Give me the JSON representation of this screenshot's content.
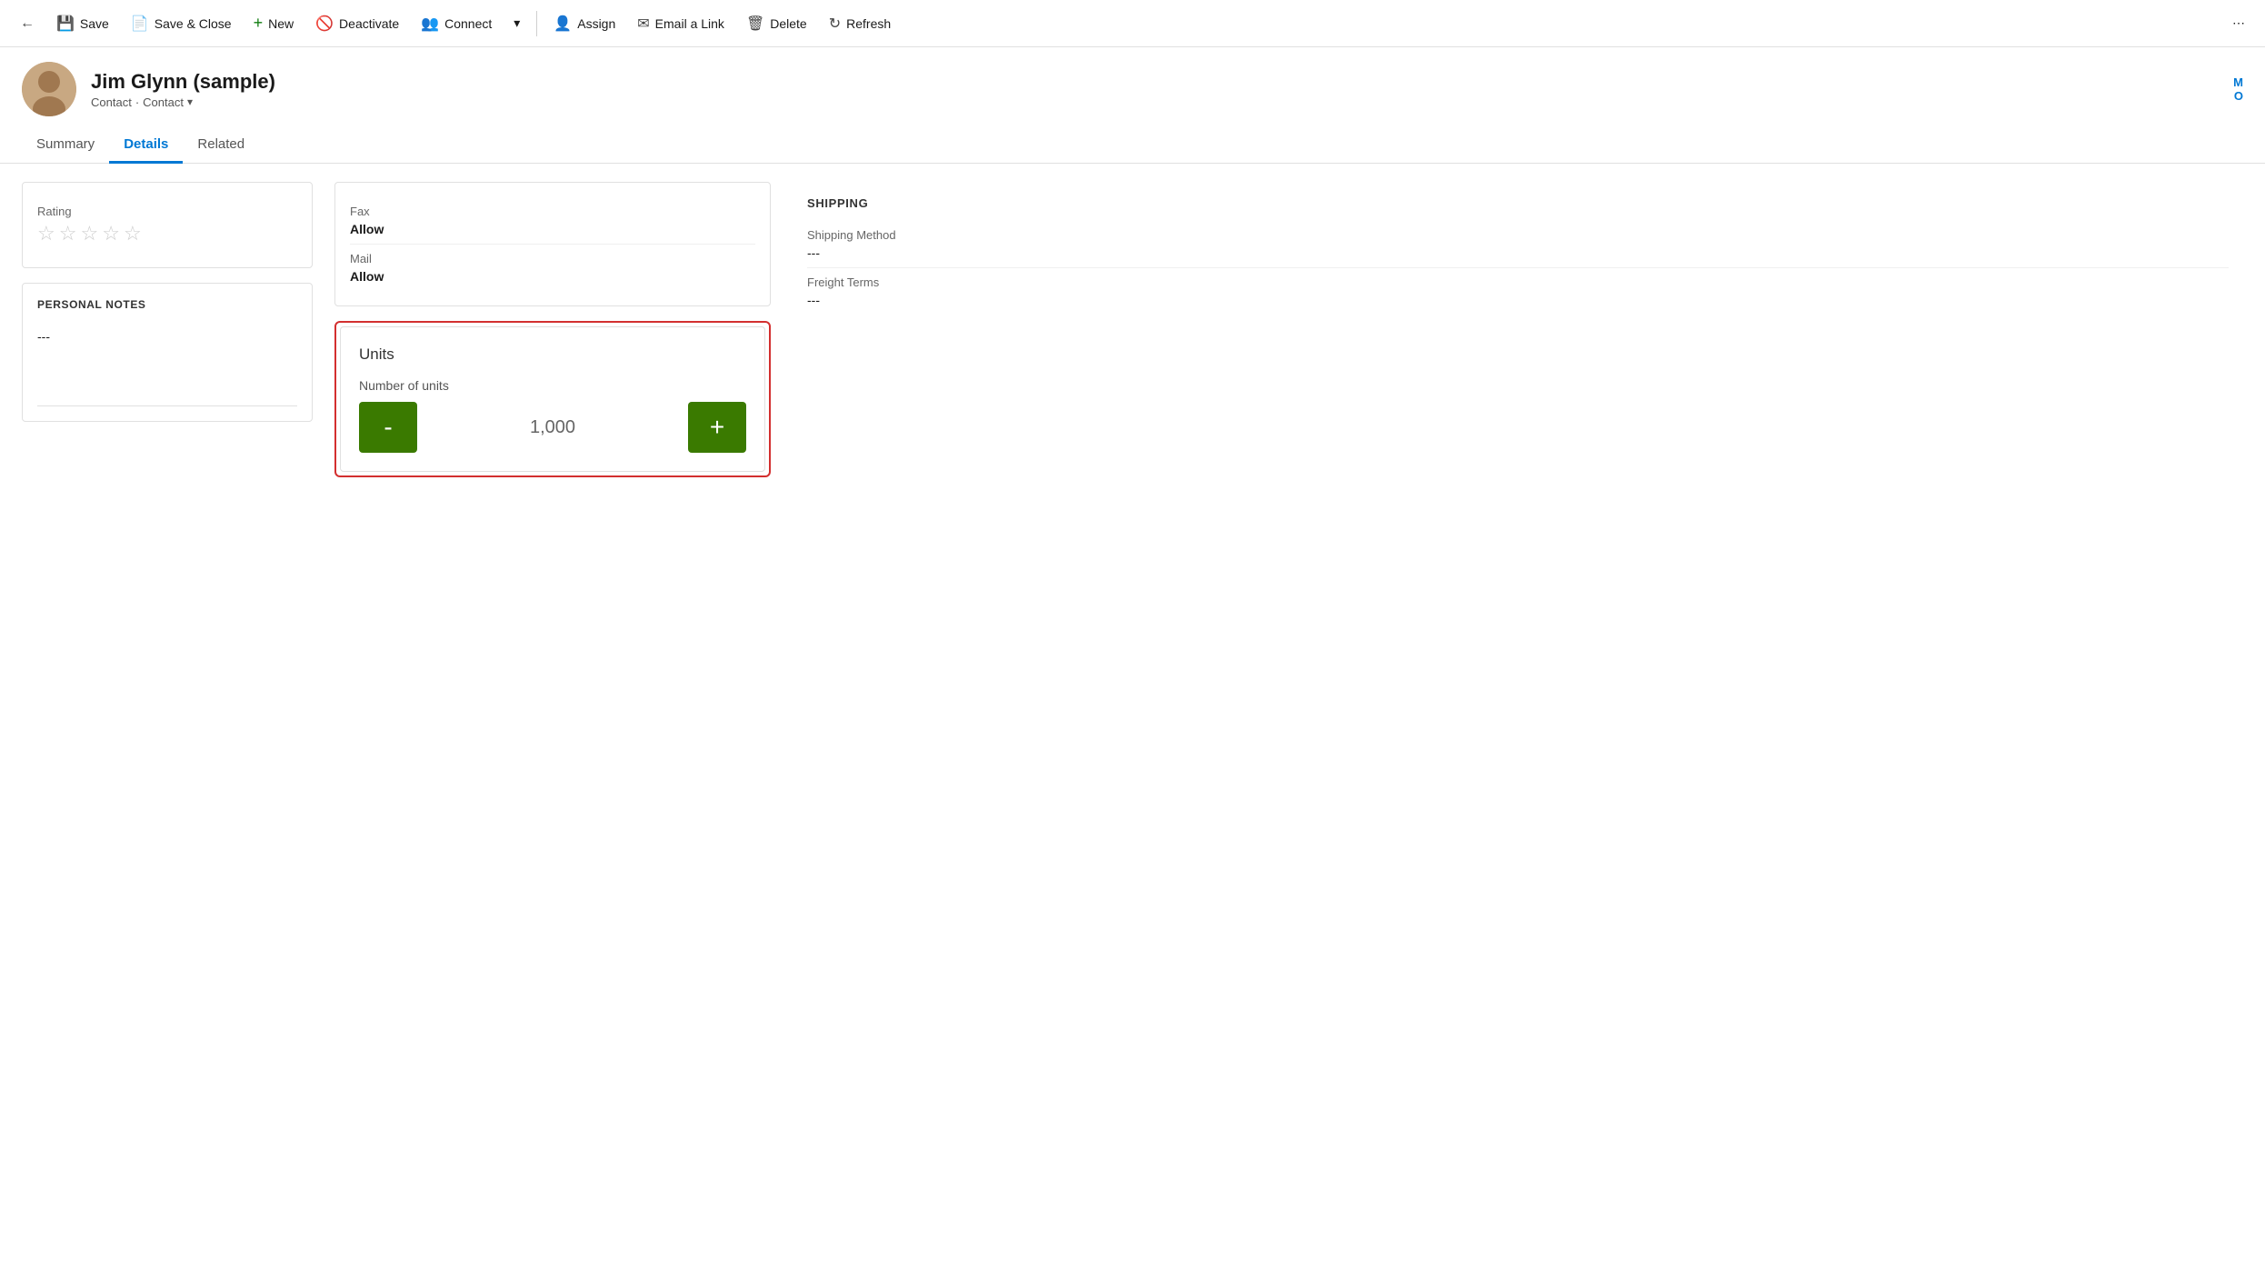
{
  "toolbar": {
    "back_icon": "←",
    "save_label": "Save",
    "save_close_label": "Save & Close",
    "new_label": "New",
    "deactivate_label": "Deactivate",
    "connect_label": "Connect",
    "dropdown_icon": "▾",
    "assign_label": "Assign",
    "email_link_label": "Email a Link",
    "delete_label": "Delete",
    "refresh_label": "Refresh",
    "more_icon": "⋯"
  },
  "record": {
    "name": "Jim Glynn (sample)",
    "type1": "Contact",
    "type2": "Contact",
    "corner_label1": "M",
    "corner_label2": "O"
  },
  "tabs": [
    {
      "label": "Summary",
      "active": false
    },
    {
      "label": "Details",
      "active": true
    },
    {
      "label": "Related",
      "active": false
    }
  ],
  "rating_card": {
    "field_label": "Rating",
    "stars": [
      "☆",
      "☆",
      "☆",
      "☆",
      "☆"
    ]
  },
  "personal_notes_card": {
    "title": "PERSONAL NOTES",
    "value": "---"
  },
  "contact_prefs_card": {
    "fax_label": "Fax",
    "fax_value": "Allow",
    "mail_label": "Mail",
    "mail_value": "Allow"
  },
  "units_card": {
    "title": "Units",
    "field_label": "Number of units",
    "value": "1,000",
    "minus_label": "-",
    "plus_label": "+"
  },
  "shipping_section": {
    "title": "SHIPPING",
    "method_label": "Shipping Method",
    "method_value": "---",
    "terms_label": "Freight Terms",
    "terms_value": "---"
  }
}
